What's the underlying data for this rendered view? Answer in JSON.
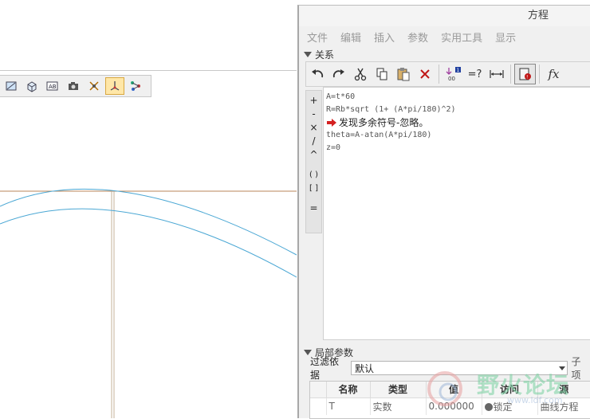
{
  "dialog": {
    "title": "方程",
    "menu": [
      "文件",
      "编辑",
      "插入",
      "参数",
      "实用工具",
      "显示"
    ],
    "relations_label": "关系",
    "operators": [
      "+",
      "-",
      "×",
      "/",
      "^",
      "( )",
      "[ ]",
      "="
    ],
    "relations_lines": [
      "A=t*60",
      "R=Rb*sqrt (1+ (A*pi/180)^2)",
      "theta=A-atan(A*pi/180)",
      "z=0"
    ],
    "warning": "发现多余符号-忽略。",
    "toolbar_text": {
      "eq_check": "=?",
      "fx": "fx",
      "sort_digits": "00",
      "sort_badge": "1"
    },
    "local_params_label": "局部参数",
    "filter_label": "过滤依据",
    "filter_value": "默认",
    "filter_right": "子项",
    "table": {
      "headers": [
        "名称",
        "类型",
        "值",
        "访问",
        "源"
      ],
      "rows": [
        {
          "name": "T",
          "type": "实数",
          "value": "0.000000",
          "access": "锁定",
          "source": "曲线方程"
        }
      ]
    }
  },
  "watermark": {
    "text": "野火论坛",
    "url": "www.ldf.com"
  },
  "colors": {
    "curve": "#4aa7d4",
    "axis": "#b8865a",
    "warning_arrow": "#d42020"
  }
}
